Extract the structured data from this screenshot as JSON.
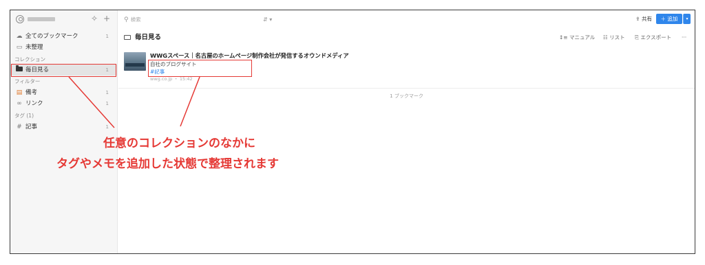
{
  "sidebar": {
    "search_placeholder": "検索",
    "items": [
      {
        "label": "全てのブックマーク",
        "count": "1",
        "icon": "cloud-icon"
      },
      {
        "label": "未整理",
        "count": "",
        "icon": "inbox-icon"
      }
    ],
    "collections_heading": "コレクション",
    "collections": [
      {
        "label": "毎日見る",
        "count": "1"
      }
    ],
    "filters_heading": "フィルター",
    "filters": [
      {
        "label": "備考",
        "count": "1",
        "icon": "note-icon"
      },
      {
        "label": "リンク",
        "count": "1",
        "icon": "link-icon"
      }
    ],
    "tags_heading": "タグ (1)",
    "tags": [
      {
        "label": "記事",
        "count": "1",
        "prefix": "#"
      }
    ]
  },
  "topbar": {
    "search_placeholder": "検索",
    "share_label": "共有",
    "add_label": "＋ 追加"
  },
  "collection": {
    "title": "毎日見る",
    "actions": [
      "マニュアル",
      "リスト",
      "エクスポート",
      "···"
    ]
  },
  "bookmark": {
    "title": "WWGスペース｜名古屋のホームページ制作会社が発信するオウンドメディア",
    "excerpt": "自社のブログサイト",
    "tag": "#記事",
    "meta": "wwg.co.jp ・ 15:42"
  },
  "count_label": "1 ブックマーク",
  "annotation": {
    "line1": "任意のコレクションのなかに",
    "line2": "タグやメモを追加した状態で整理されます"
  },
  "colors": {
    "accent": "#2f86eb",
    "highlight": "#e53935"
  }
}
